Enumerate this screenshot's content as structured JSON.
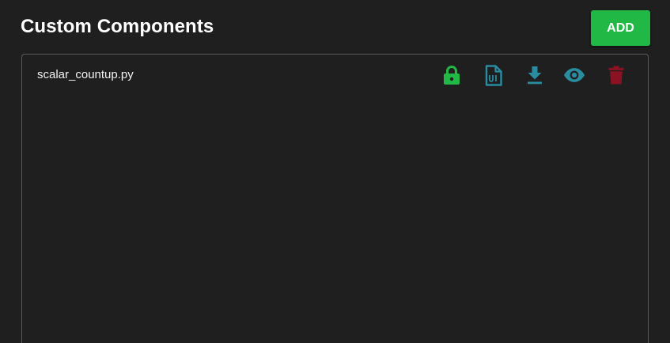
{
  "header": {
    "title": "Custom Components",
    "add_label": "ADD"
  },
  "components": [
    {
      "filename": "scalar_countup.py",
      "actions": [
        {
          "name": "lock-icon",
          "color": "#22b845"
        },
        {
          "name": "ui-file-icon",
          "color": "#2a8ca0"
        },
        {
          "name": "download-icon",
          "color": "#2a8ca0"
        },
        {
          "name": "eye-icon",
          "color": "#2a8ca0"
        },
        {
          "name": "trash-icon",
          "color": "#8b1222"
        }
      ]
    }
  ],
  "colors": {
    "background": "#1f1f1f",
    "accent_green": "#22b845",
    "accent_teal": "#2a8ca0",
    "danger_red": "#8b1222",
    "panel_border": "#5a5a5a"
  }
}
